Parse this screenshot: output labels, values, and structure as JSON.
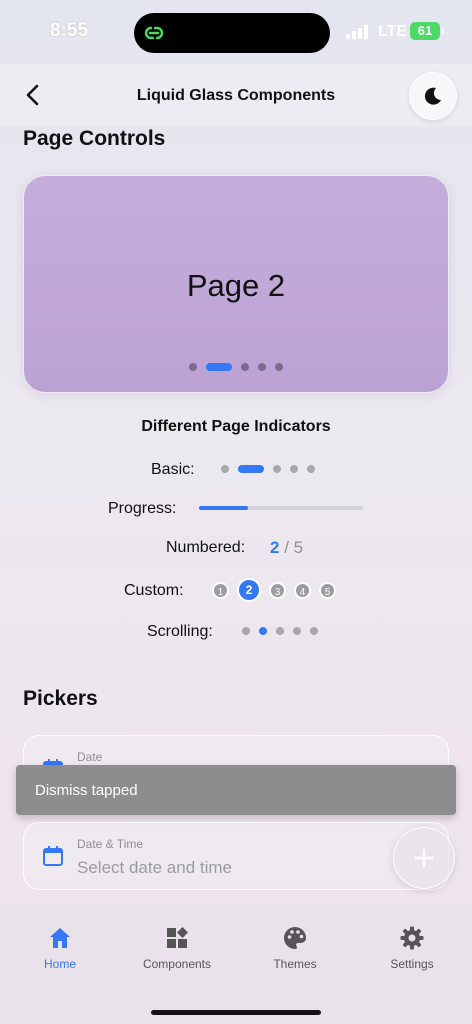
{
  "status_bar": {
    "time": "8:55",
    "network": "LTE",
    "battery": "61"
  },
  "nav": {
    "title": "Liquid Glass Components",
    "back_icon": "chevron-left-icon",
    "theme_icon": "moon-icon"
  },
  "page_controls": {
    "section_title": "Page Controls",
    "current_page_label": "Page 2",
    "page_count": 5,
    "current_page": 2
  },
  "indicators": {
    "title": "Different Page Indicators",
    "basic_label": "Basic:",
    "progress_label": "Progress:",
    "progress_fraction": 0.3,
    "numbered_label": "Numbered:",
    "numbered_current": "2",
    "numbered_separator": "/",
    "numbered_total": "5",
    "custom_label": "Custom:",
    "custom_numbers": [
      "1",
      "2",
      "3",
      "4",
      "5"
    ],
    "scrolling_label": "Scrolling:"
  },
  "pickers": {
    "section_title": "Pickers",
    "date": {
      "label": "Date"
    },
    "datetime": {
      "label": "Date & Time",
      "placeholder": "Select date and time"
    }
  },
  "snackbar": {
    "text": "Dismiss tapped"
  },
  "tabs": [
    {
      "label": "Home",
      "icon": "home-icon",
      "active": true
    },
    {
      "label": "Components",
      "icon": "components-icon",
      "active": false
    },
    {
      "label": "Themes",
      "icon": "palette-icon",
      "active": false
    },
    {
      "label": "Settings",
      "icon": "gear-icon",
      "active": false
    }
  ],
  "colors": {
    "accent": "#3478f6",
    "pager_card": "#bfa6d8",
    "snackbar": "#8d8d90"
  }
}
